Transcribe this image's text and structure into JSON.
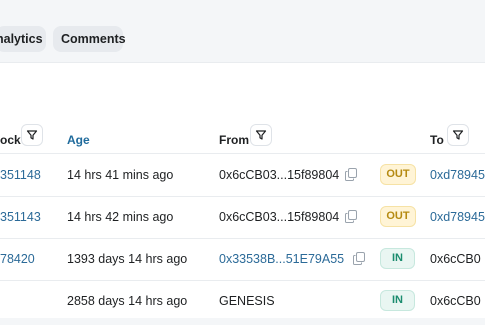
{
  "tabs": [
    {
      "label": "nalytics"
    },
    {
      "label": "Comments"
    }
  ],
  "table": {
    "columns": {
      "block": "ock",
      "age": "Age",
      "from": "From",
      "to": "To"
    },
    "rows": [
      {
        "block": "351148",
        "age": "14 hrs 41 mins ago",
        "from": "0x6cCB03...15f89804",
        "direction": "OUT",
        "to": "0xd78945"
      },
      {
        "block": "351143",
        "age": "14 hrs 42 mins ago",
        "from": "0x6cCB03...15f89804",
        "direction": "OUT",
        "to": "0xd78945"
      },
      {
        "block": "78420",
        "age": "1393 days 14 hrs ago",
        "from": "0x33538B...51E79A55",
        "direction": "IN",
        "to": "0x6cCB0"
      },
      {
        "block": "",
        "age": "2858 days 14 hrs ago",
        "from": "GENESIS",
        "direction": "IN",
        "to": "0x6cCB0"
      }
    ]
  },
  "colors": {
    "link": "#2b6a98",
    "out_badge": "#b58a11",
    "in_badge": "#1a8c6e",
    "background": "#f4f6f8"
  },
  "icons": [
    "filter-icon",
    "copy-icon"
  ]
}
